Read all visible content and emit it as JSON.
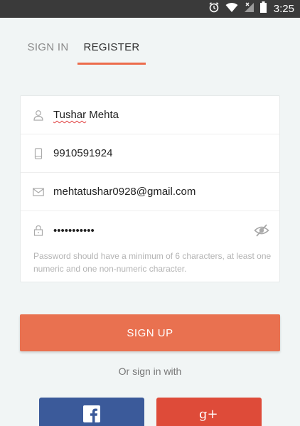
{
  "status_bar": {
    "time": "3:25"
  },
  "tabs": {
    "sign_in": "SIGN IN",
    "register": "REGISTER",
    "active": "register"
  },
  "form": {
    "name_first": "Tushar",
    "name_last": " Mehta",
    "phone": "9910591924",
    "email": "mehtatushar0928@gmail.com",
    "password": "•••••••••••",
    "password_hint": "Password should have a minimum of 6 characters, at least one numeric and one non-numeric character."
  },
  "buttons": {
    "sign_up": "SIGN UP"
  },
  "or_text": "Or sign in with",
  "social": {
    "facebook_icon": "facebook-icon",
    "google_icon": "google-plus-icon"
  },
  "colors": {
    "accent": "#e97150",
    "facebook": "#3b5a9a",
    "google": "#de4b39"
  }
}
